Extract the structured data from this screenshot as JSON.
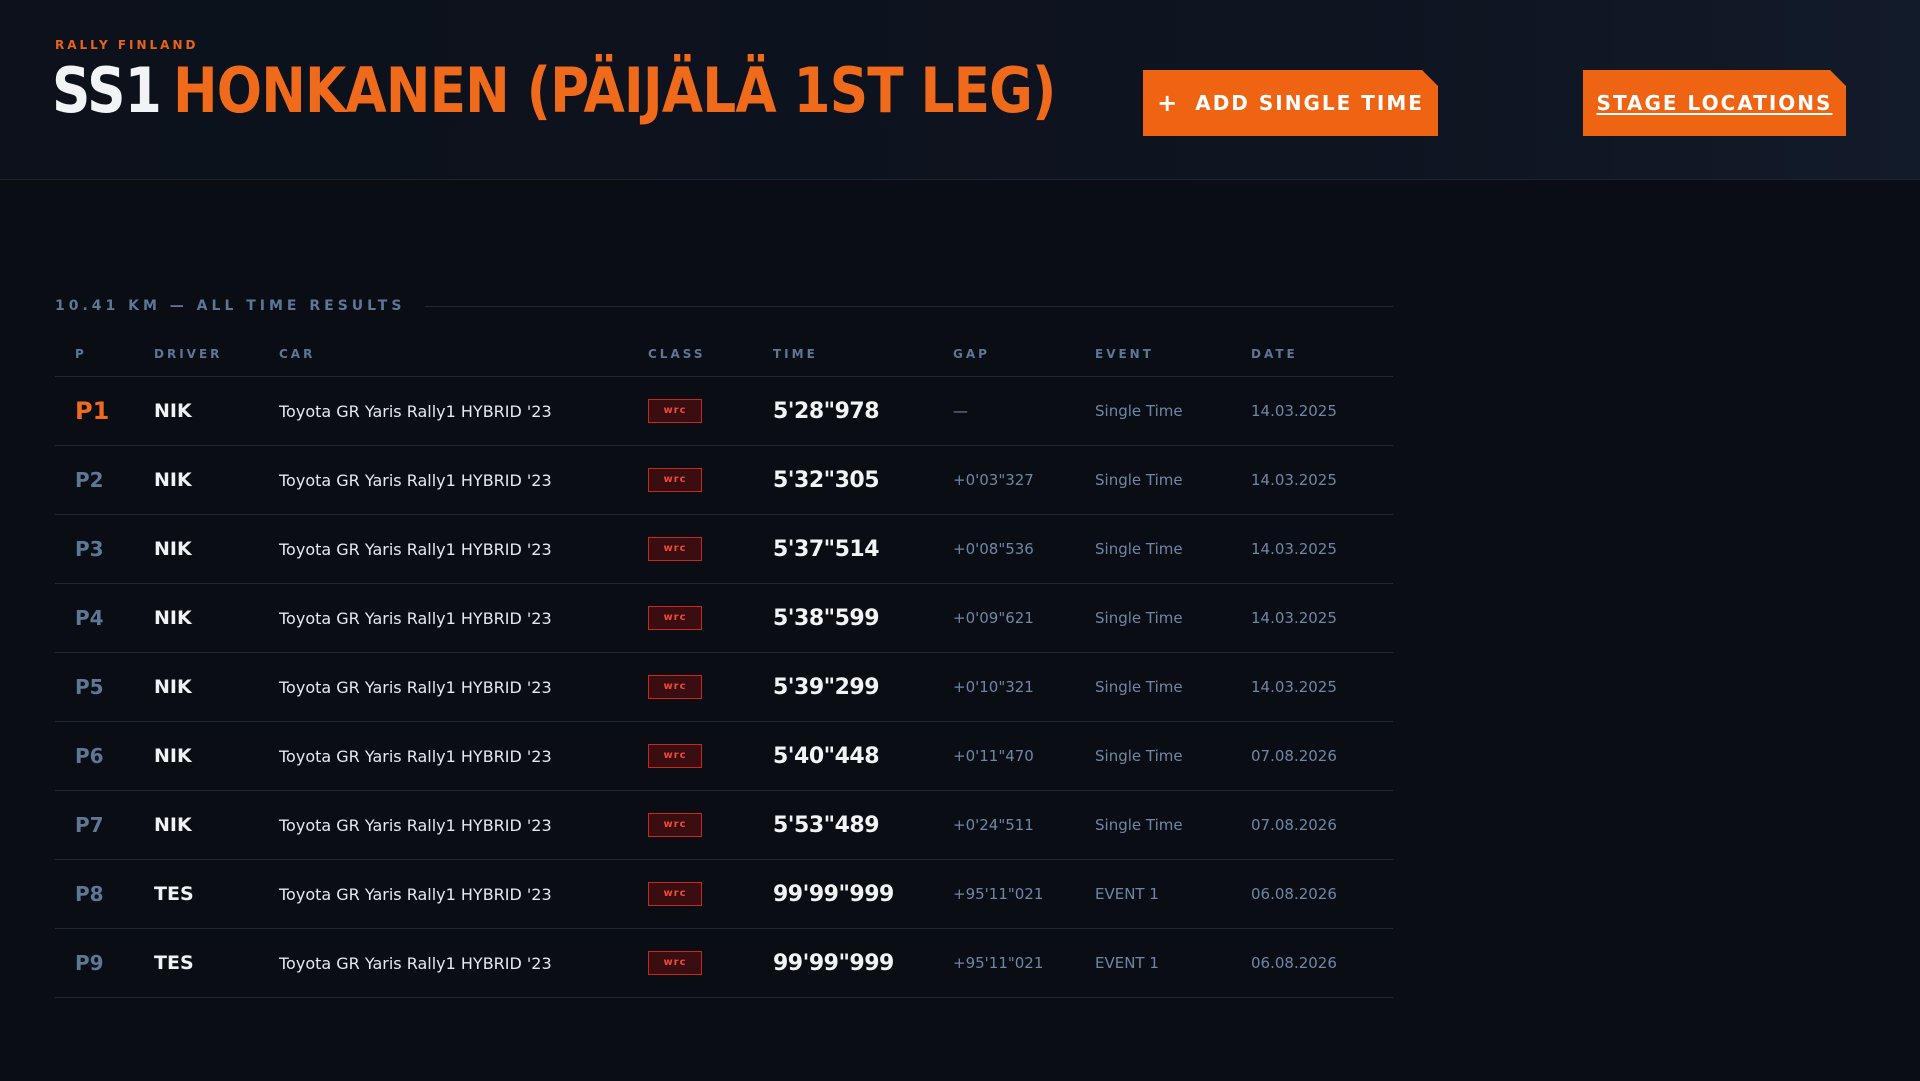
{
  "header": {
    "kicker": "RALLY FINLAND",
    "stage_code": "SS1",
    "stage_name": "HONKANEN (PÄIJÄLÄ 1ST LEG)",
    "add_button_icon": "plus-icon",
    "add_button_label": "ADD SINGLE TIME",
    "locations_button_label": "STAGE LOCATIONS"
  },
  "results": {
    "section_label": "10.41 KM — ALL TIME RESULTS",
    "columns": {
      "p": "P",
      "driver": "DRIVER",
      "car": "CAR",
      "class": "CLASS",
      "time": "TIME",
      "gap": "GAP",
      "event": "EVENT",
      "date": "DATE"
    },
    "rows": [
      {
        "p": "P1",
        "driver": "NIK",
        "car": "Toyota GR Yaris Rally1 HYBRID '23",
        "class": "wrc",
        "time": "5'28\"978",
        "gap": "—",
        "event": "Single Time",
        "date": "14.03.2025"
      },
      {
        "p": "P2",
        "driver": "NIK",
        "car": "Toyota GR Yaris Rally1 HYBRID '23",
        "class": "wrc",
        "time": "5'32\"305",
        "gap": "+0'03\"327",
        "event": "Single Time",
        "date": "14.03.2025"
      },
      {
        "p": "P3",
        "driver": "NIK",
        "car": "Toyota GR Yaris Rally1 HYBRID '23",
        "class": "wrc",
        "time": "5'37\"514",
        "gap": "+0'08\"536",
        "event": "Single Time",
        "date": "14.03.2025"
      },
      {
        "p": "P4",
        "driver": "NIK",
        "car": "Toyota GR Yaris Rally1 HYBRID '23",
        "class": "wrc",
        "time": "5'38\"599",
        "gap": "+0'09\"621",
        "event": "Single Time",
        "date": "14.03.2025"
      },
      {
        "p": "P5",
        "driver": "NIK",
        "car": "Toyota GR Yaris Rally1 HYBRID '23",
        "class": "wrc",
        "time": "5'39\"299",
        "gap": "+0'10\"321",
        "event": "Single Time",
        "date": "14.03.2025"
      },
      {
        "p": "P6",
        "driver": "NIK",
        "car": "Toyota GR Yaris Rally1 HYBRID '23",
        "class": "wrc",
        "time": "5'40\"448",
        "gap": "+0'11\"470",
        "event": "Single Time",
        "date": "07.08.2026"
      },
      {
        "p": "P7",
        "driver": "NIK",
        "car": "Toyota GR Yaris Rally1 HYBRID '23",
        "class": "wrc",
        "time": "5'53\"489",
        "gap": "+0'24\"511",
        "event": "Single Time",
        "date": "07.08.2026"
      },
      {
        "p": "P8",
        "driver": "TES",
        "car": "Toyota GR Yaris Rally1 HYBRID '23",
        "class": "wrc",
        "time": "99'99\"999",
        "gap": "+95'11\"021",
        "event": "EVENT 1",
        "date": "06.08.2026"
      },
      {
        "p": "P9",
        "driver": "TES",
        "car": "Toyota GR Yaris Rally1 HYBRID '23",
        "class": "wrc",
        "time": "99'99\"999",
        "gap": "+95'11\"021",
        "event": "EVENT 1",
        "date": "06.08.2026"
      }
    ]
  },
  "colors": {
    "accent": "#ef6412",
    "background": "#0a0d14",
    "muted": "#5d7796",
    "badge_red": "#c7281e"
  }
}
